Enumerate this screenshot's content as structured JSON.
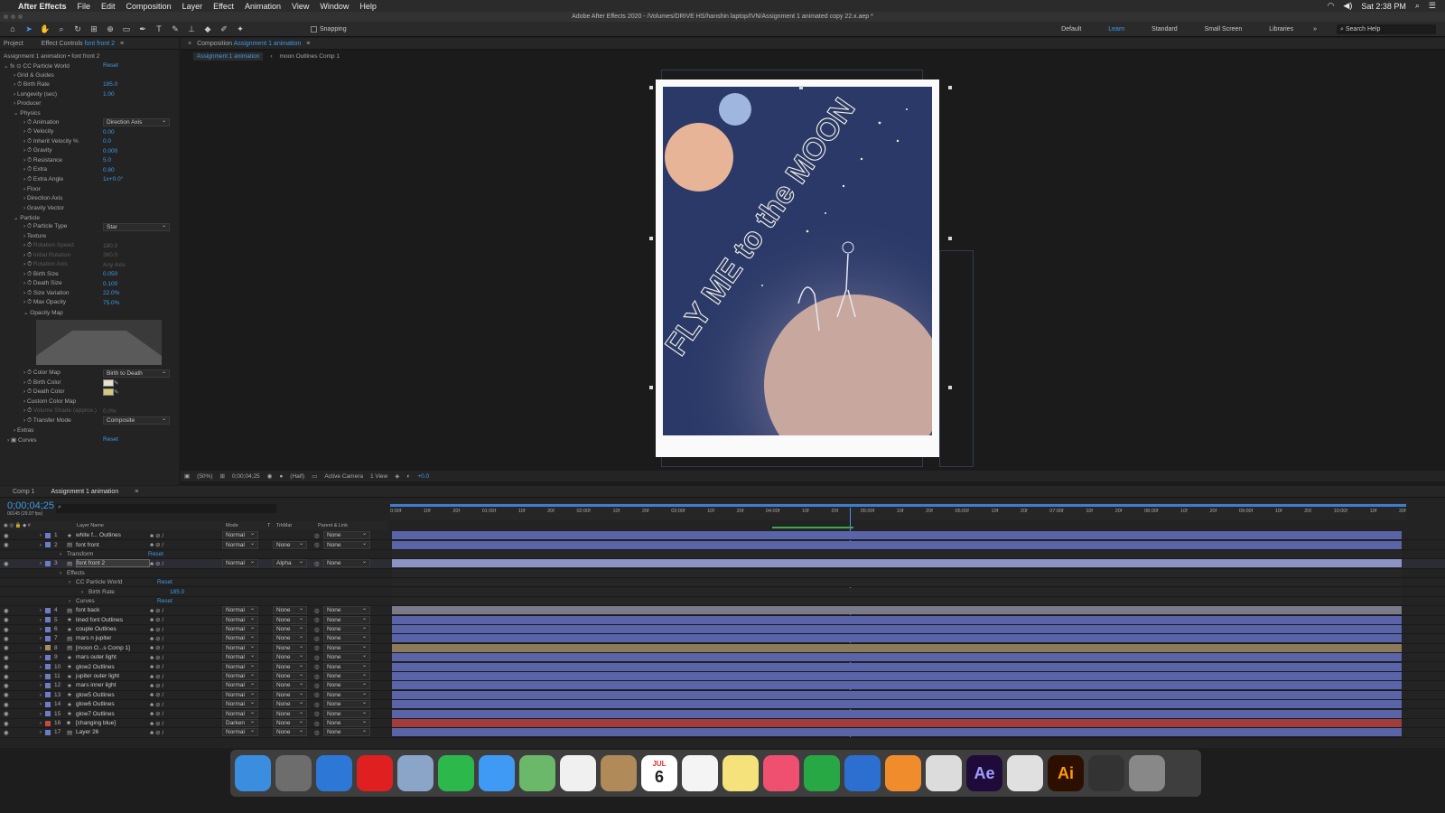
{
  "menubar": {
    "app": "After Effects",
    "items": [
      "File",
      "Edit",
      "Composition",
      "Layer",
      "Effect",
      "Animation",
      "View",
      "Window",
      "Help"
    ],
    "clock": "Sat 2:38 PM"
  },
  "titlebar": {
    "title": "Adobe After Effects 2020 - /Volumes/DRIVE HS/hanshin laptop/IVN/Assignment 1 animated copy 22.x.aep *"
  },
  "toolbar": {
    "snapping": "Snapping",
    "workspaces": [
      "Default",
      "Learn",
      "Standard",
      "Small Screen",
      "Libraries"
    ],
    "active_workspace": "Learn",
    "search_placeholder": "Search Help"
  },
  "project_panel": {
    "tab": "Project"
  },
  "effect_controls": {
    "tab_prefix": "Effect Controls",
    "tab_layer": "font front 2",
    "breadcrumb": "Assignment 1 animation • font front 2",
    "effect_name": "CC Particle World",
    "reset": "Reset",
    "rows": [
      {
        "label": "Grid & Guides",
        "indent": 1,
        "type": "group"
      },
      {
        "label": "Birth Rate",
        "indent": 1,
        "value": "185.0",
        "sw": true
      },
      {
        "label": "Longevity (sec)",
        "indent": 1,
        "value": "1.00"
      },
      {
        "label": "Producer",
        "indent": 1,
        "type": "group"
      },
      {
        "label": "Physics",
        "indent": 1,
        "type": "open"
      },
      {
        "label": "Animation",
        "indent": 2,
        "dropdown": "Direction Axis",
        "sw": true
      },
      {
        "label": "Velocity",
        "indent": 2,
        "value": "0.00",
        "sw": true
      },
      {
        "label": "Inherit Velocity %",
        "indent": 2,
        "value": "0.0",
        "sw": true
      },
      {
        "label": "Gravity",
        "indent": 2,
        "value": "0.000",
        "sw": true
      },
      {
        "label": "Resistance",
        "indent": 2,
        "value": "5.0",
        "sw": true
      },
      {
        "label": "Extra",
        "indent": 2,
        "value": "0.80",
        "sw": true
      },
      {
        "label": "Extra Angle",
        "indent": 2,
        "value": "1x+0.0°",
        "sw": true
      },
      {
        "label": "Floor",
        "indent": 2,
        "type": "group"
      },
      {
        "label": "Direction Axis",
        "indent": 2,
        "type": "group"
      },
      {
        "label": "Gravity Vector",
        "indent": 2,
        "type": "group"
      },
      {
        "label": "Particle",
        "indent": 1,
        "type": "open"
      },
      {
        "label": "Particle Type",
        "indent": 2,
        "dropdown": "Star",
        "sw": true
      },
      {
        "label": "Texture",
        "indent": 2,
        "type": "group"
      },
      {
        "label": "Rotation Speed",
        "indent": 2,
        "value": "180.0",
        "disabled": true,
        "sw": true
      },
      {
        "label": "Initial Rotation",
        "indent": 2,
        "value": "360.0",
        "disabled": true,
        "sw": true
      },
      {
        "label": "Rotation Axis",
        "indent": 2,
        "value": "Any Axis",
        "disabled": true,
        "sw": true
      },
      {
        "label": "Birth Size",
        "indent": 2,
        "value": "0.050",
        "sw": true
      },
      {
        "label": "Death Size",
        "indent": 2,
        "value": "0.100",
        "sw": true
      },
      {
        "label": "Size Variation",
        "indent": 2,
        "value": "22.0%",
        "sw": true
      },
      {
        "label": "Max Opacity",
        "indent": 2,
        "value": "75.0%",
        "sw": true
      },
      {
        "label": "Opacity Map",
        "indent": 2,
        "type": "open"
      }
    ],
    "rows2": [
      {
        "label": "Color Map",
        "indent": 2,
        "dropdown": "Birth to Death",
        "sw": true
      },
      {
        "label": "Birth Color",
        "indent": 2,
        "swatch": "#e8e0c8",
        "sw": true
      },
      {
        "label": "Death Color",
        "indent": 2,
        "swatch": "#d8c878",
        "sw": true
      },
      {
        "label": "Custom Color Map",
        "indent": 2,
        "type": "group"
      },
      {
        "label": "Volume Shade (approx.)",
        "indent": 2,
        "value": "0.0%",
        "disabled": true,
        "sw": true
      },
      {
        "label": "Transfer Mode",
        "indent": 2,
        "dropdown": "Composite",
        "sw": true
      },
      {
        "label": "Extras",
        "indent": 1,
        "type": "group"
      },
      {
        "label": "Curves",
        "indent": 0,
        "value": "Reset",
        "fx": true
      }
    ]
  },
  "composition": {
    "tab_prefix": "Composition",
    "tab_name": "Assignment 1 animation",
    "crumbs": [
      "Assignment 1 animation",
      "moon Outlines Comp 1"
    ],
    "poster_text": "FLY ME to the MOON",
    "footer": {
      "zoom": "(50%)",
      "time": "0;00;04;25",
      "resolution": "(Half)",
      "camera": "Active Camera",
      "views": "1 View",
      "exposure": "+0.0"
    }
  },
  "timeline": {
    "tabs": [
      "Comp 1",
      "Assignment 1 animation"
    ],
    "timecode": "0;00;04;25",
    "timecode_sub": "00145 (29.97 fps)",
    "cols": {
      "layer": "Layer Name",
      "mode": "Mode",
      "t": "T",
      "trkmat": "TrkMat",
      "parent": "Parent & Link"
    },
    "ruler": [
      "0:00f",
      "10f",
      "20f",
      "01:00f",
      "10f",
      "20f",
      "02:00f",
      "10f",
      "20f",
      "03:00f",
      "10f",
      "20f",
      "04:00f",
      "10f",
      "20f",
      "05:00f",
      "10f",
      "20f",
      "06:00f",
      "10f",
      "20f",
      "07:00f",
      "10f",
      "20f",
      "08:00f",
      "10f",
      "20f",
      "09:00f",
      "10f",
      "20f",
      "10:00f",
      "10f",
      "20f"
    ],
    "layers": [
      {
        "n": "1",
        "name": "white f... Outlines",
        "mode": "Normal",
        "trk": "",
        "parent": "None",
        "icon": "star",
        "color": "#6b7dc9",
        "bar": "#5a64a8"
      },
      {
        "n": "2",
        "name": "font front",
        "mode": "Normal",
        "trk": "None",
        "parent": "None",
        "icon": "comp",
        "color": "#6b7dc9",
        "bar": "#5a64a8"
      },
      {
        "sub": "Transform",
        "reset": "Reset"
      },
      {
        "n": "3",
        "name": "font front 2",
        "mode": "Normal",
        "trk": "Alpha",
        "parent": "None",
        "icon": "comp",
        "color": "#6b7dc9",
        "bar": "#8c93c7",
        "selected": true
      },
      {
        "sub": "Effects"
      },
      {
        "sub": "CC Particle World",
        "reset": "Reset",
        "deep": true
      },
      {
        "sub": "Birth Rate",
        "value": "185.0",
        "deeper": true
      },
      {
        "sub": "Curves",
        "reset": "Reset",
        "deep2": true
      },
      {
        "n": "4",
        "name": "font back",
        "mode": "Normal",
        "trk": "None",
        "parent": "None",
        "icon": "comp",
        "color": "#6b7dc9",
        "bar": "#7a7a8a"
      },
      {
        "n": "5",
        "name": "lined font Outlines",
        "mode": "Normal",
        "trk": "None",
        "parent": "None",
        "icon": "star",
        "color": "#6b7dc9",
        "bar": "#5a64a8"
      },
      {
        "n": "6",
        "name": "couple Outlines",
        "mode": "Normal",
        "trk": "None",
        "parent": "None",
        "icon": "star",
        "color": "#6b7dc9",
        "bar": "#5a64a8"
      },
      {
        "n": "7",
        "name": "mars n jupiter",
        "mode": "Normal",
        "trk": "None",
        "parent": "None",
        "icon": "comp",
        "color": "#6b7dc9",
        "bar": "#5a64a8"
      },
      {
        "n": "8",
        "name": "[moon O...s Comp 1]",
        "mode": "Normal",
        "trk": "None",
        "parent": "None",
        "icon": "comp",
        "color": "#a8905e",
        "bar": "#8c7a5a"
      },
      {
        "n": "9",
        "name": "mars outer light",
        "mode": "Normal",
        "trk": "None",
        "parent": "None",
        "icon": "star",
        "color": "#6b7dc9",
        "bar": "#5a64a8"
      },
      {
        "n": "10",
        "name": "glow2 Outlines",
        "mode": "Normal",
        "trk": "None",
        "parent": "None",
        "icon": "star",
        "color": "#6b7dc9",
        "bar": "#5a64a8"
      },
      {
        "n": "11",
        "name": "jupiter outer light",
        "mode": "Normal",
        "trk": "None",
        "parent": "None",
        "icon": "star",
        "color": "#6b7dc9",
        "bar": "#5a64a8"
      },
      {
        "n": "12",
        "name": "mars inner light",
        "mode": "Normal",
        "trk": "None",
        "parent": "None",
        "icon": "star",
        "color": "#6b7dc9",
        "bar": "#5a64a8"
      },
      {
        "n": "13",
        "name": "glow5 Outlines",
        "mode": "Normal",
        "trk": "None",
        "parent": "None",
        "icon": "star",
        "color": "#6b7dc9",
        "bar": "#5a64a8"
      },
      {
        "n": "14",
        "name": "glow6 Outlines",
        "mode": "Normal",
        "trk": "None",
        "parent": "None",
        "icon": "star",
        "color": "#6b7dc9",
        "bar": "#5a64a8"
      },
      {
        "n": "15",
        "name": "glow7 Outlines",
        "mode": "Normal",
        "trk": "None",
        "parent": "None",
        "icon": "star",
        "color": "#6b7dc9",
        "bar": "#5a64a8"
      },
      {
        "n": "16",
        "name": "[changing blue]",
        "mode": "Darken",
        "trk": "None",
        "parent": "None",
        "icon": "solid",
        "color": "#c84848",
        "bar": "#a03c3c"
      },
      {
        "n": "17",
        "name": "Layer 26",
        "mode": "Normal",
        "trk": "None",
        "parent": "None",
        "icon": "comp",
        "color": "#6b7dc9",
        "bar": "#5a64a8"
      }
    ]
  },
  "dock": {
    "calendar_day": "6",
    "calendar_month": "JUL",
    "items": [
      {
        "name": "finder-icon",
        "bg": "#3b8de0"
      },
      {
        "name": "launchpad-icon",
        "bg": "#6d6d6d"
      },
      {
        "name": "safari-icon",
        "bg": "#2d78d6"
      },
      {
        "name": "opera-icon",
        "bg": "#e02020"
      },
      {
        "name": "preview-icon",
        "bg": "#8aa5c8"
      },
      {
        "name": "facetime-icon",
        "bg": "#2cb84a"
      },
      {
        "name": "messages-icon",
        "bg": "#3e9af5"
      },
      {
        "name": "maps-icon",
        "bg": "#6cb86a"
      },
      {
        "name": "photos-icon",
        "bg": "#f0f0f0"
      },
      {
        "name": "contacts-icon",
        "bg": "#b08a58"
      },
      {
        "name": "calendar-icon",
        "bg": "#ffffff"
      },
      {
        "name": "reminders-icon",
        "bg": "#f4f4f4"
      },
      {
        "name": "notes-icon",
        "bg": "#f5e27a"
      },
      {
        "name": "music-icon",
        "bg": "#f05070"
      },
      {
        "name": "numbers-icon",
        "bg": "#27a845"
      },
      {
        "name": "keynote-icon",
        "bg": "#2c6fd0"
      },
      {
        "name": "pages-icon",
        "bg": "#f08c2c"
      },
      {
        "name": "sketchup-icon",
        "bg": "#dcdcdc"
      },
      {
        "name": "after-effects-icon",
        "bg": "#1f0b3a",
        "label": "Ae",
        "fg": "#9f9fff"
      },
      {
        "name": "chrome-icon",
        "bg": "#e0e0e0"
      },
      {
        "name": "illustrator-icon",
        "bg": "#2d0f00",
        "label": "Ai",
        "fg": "#ff9a00"
      },
      {
        "name": "screenshot-icon",
        "bg": "#333333"
      },
      {
        "name": "trash-icon",
        "bg": "#888888"
      }
    ]
  }
}
